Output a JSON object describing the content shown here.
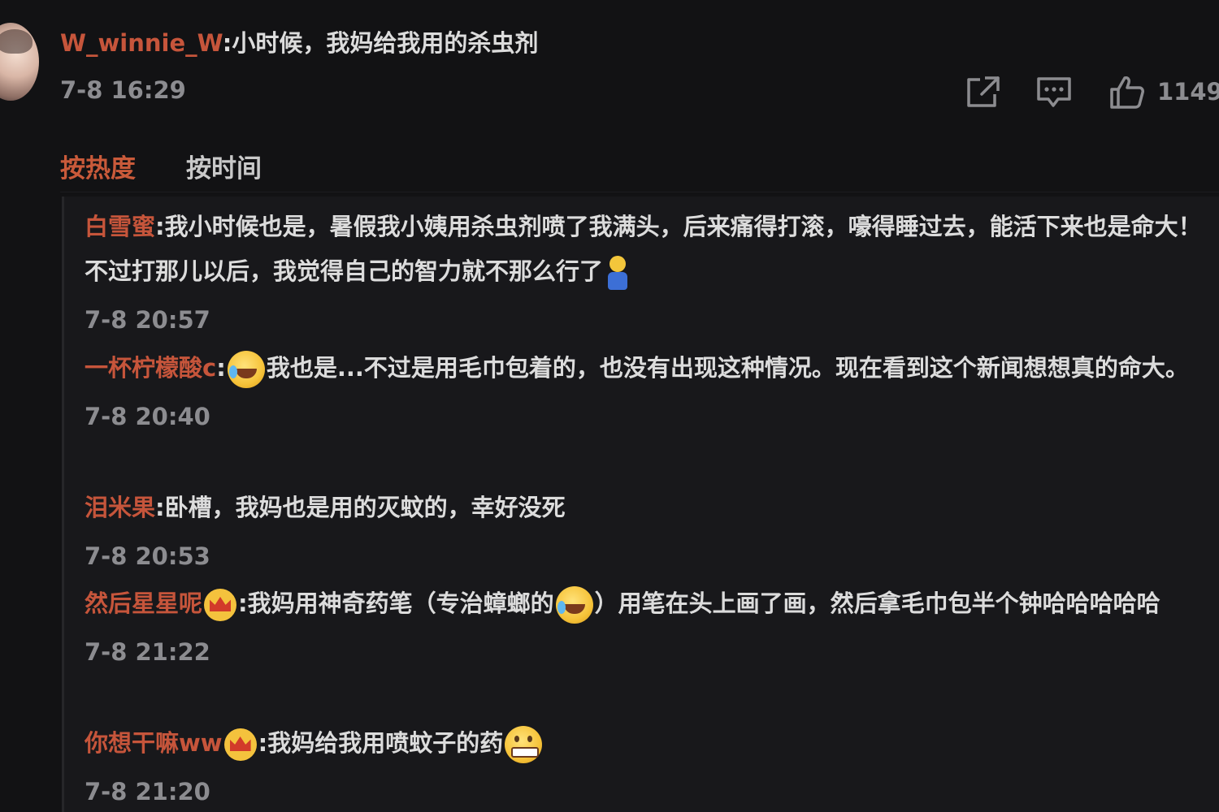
{
  "main_comment": {
    "user": "W_winnie_W",
    "separator": ":",
    "text": "小时候，我妈给我用的杀虫剂",
    "time": "7-8 16:29",
    "like_count": "1149"
  },
  "sort_tabs": {
    "hot": "按热度",
    "time": "按时间"
  },
  "colors": {
    "username": "#c6553b",
    "active_tab": "#c95a3a",
    "background": "#121214",
    "reply_background": "#18181b",
    "meta_text": "#8c8c90"
  },
  "icons": {
    "share": "share-icon",
    "comment": "comment-icon",
    "like": "thumbs-up-icon"
  },
  "replies": [
    {
      "user": "白雪蜜",
      "text_before": ":我小时候也是，暑假我小姨用杀虫剂喷了我满头，后来痛得打滚，嚎得睡过去，能活下来也是命大！不过打那儿以后，我觉得自己的智力就不那么行了",
      "emoji": "tiny-man-emoji",
      "text_after": "",
      "time": "7-8 20:57"
    },
    {
      "user": "一杯柠檬酸c",
      "text_before": ":",
      "emoji": "laughing-tears-emoji",
      "text_after": "我也是...不过是用毛巾包着的，也没有出现这种情况。现在看到这个新闻想想真的命大。",
      "time": "7-8 20:40"
    },
    {
      "user": "泪米果",
      "text_before": ":卧槽，我妈也是用的灭蚊的，幸好没死",
      "time": "7-8 20:53"
    },
    {
      "user": "然后星星呢",
      "badge": "crown-badge",
      "text_before": ":我妈用神奇药笔（专治蟑螂的",
      "emoji": "laughing-tears-emoji",
      "text_after": "）用笔在头上画了画，然后拿毛巾包半个钟哈哈哈哈哈",
      "time": "7-8 21:22"
    },
    {
      "user": "你想干嘛ww",
      "badge": "crown-badge",
      "text_before": ":我妈给我用喷蚊子的药",
      "emoji": "grimace-emoji",
      "text_after": "",
      "time": "7-8 21:20"
    }
  ]
}
